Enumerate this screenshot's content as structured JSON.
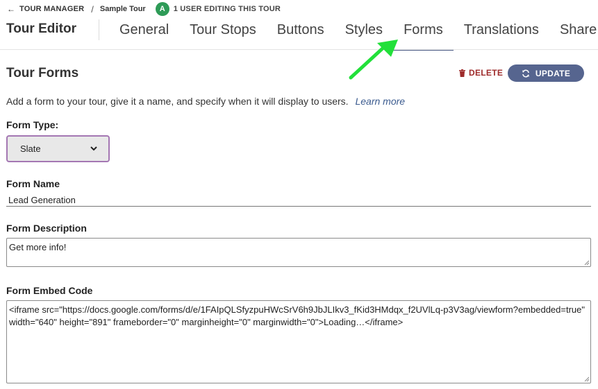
{
  "breadcrumb": {
    "back_icon": "arrow-left-icon",
    "parent": "TOUR MANAGER",
    "separator": "/",
    "current": "Sample Tour",
    "avatar_letter": "A",
    "avatar_color": "#2e9b57",
    "editing_status": "1 USER EDITING THIS TOUR"
  },
  "header": {
    "title": "Tour Editor",
    "tabs": [
      {
        "label": "General"
      },
      {
        "label": "Tour Stops"
      },
      {
        "label": "Buttons"
      },
      {
        "label": "Styles"
      },
      {
        "label": "Forms",
        "active": true
      },
      {
        "label": "Translations"
      },
      {
        "label": "Share &"
      }
    ]
  },
  "annotation": {
    "arrow_color": "#22e03a",
    "arrow_target": "Forms tab"
  },
  "section": {
    "title": "Tour Forms",
    "delete_label": "DELETE",
    "update_label": "UPDATE",
    "accent_color": "#56658f",
    "danger_color": "#9e2b2b",
    "intro_text": "Add a form to your tour, give it a name, and specify when it will display to users.",
    "learn_more": "Learn more"
  },
  "form": {
    "type_label": "Form Type:",
    "type_value": "Slate",
    "name_label": "Form Name",
    "name_value": "Lead Generation",
    "description_label": "Form Description",
    "description_value": "Get more info!",
    "embed_label": "Form Embed Code",
    "embed_value": "<iframe src=\"https://docs.google.com/forms/d/e/1FAIpQLSfyzpuHWcSrV6h9JbJLIkv3_fKid3HMdqx_f2UVlLq-p3V3ag/viewform?embedded=true\" width=\"640\" height=\"891\" frameborder=\"0\" marginheight=\"0\" marginwidth=\"0\">Loading…</iframe>"
  }
}
